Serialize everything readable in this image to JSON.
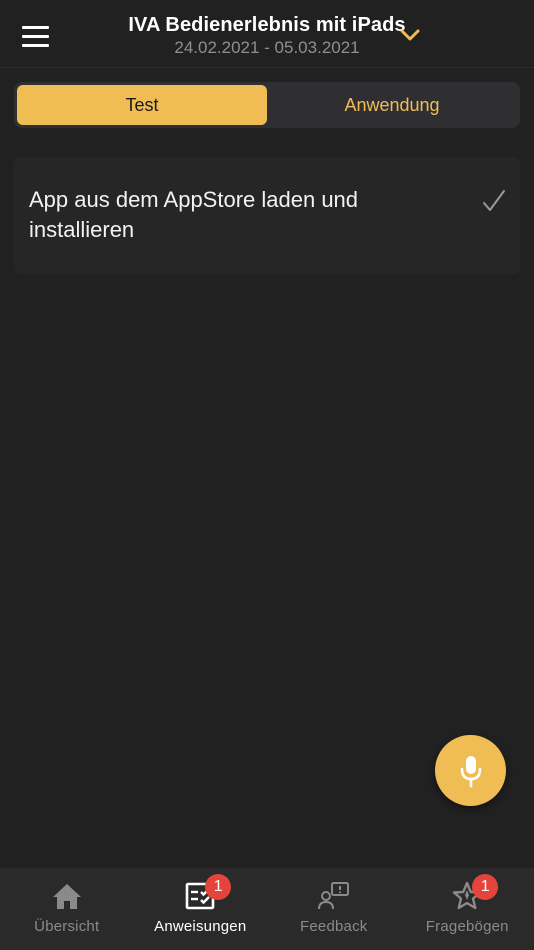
{
  "header": {
    "title": "IVA Bedienerlebnis mit iPads",
    "date_range": "24.02.2021 - 05.03.2021",
    "menu_icon": "hamburger-menu-icon",
    "chevron_icon": "chevron-down-icon"
  },
  "segments": {
    "test_label": "Test",
    "anwendung_label": "Anwendung",
    "active": "Test"
  },
  "task": {
    "text": "App aus dem AppStore laden und installieren",
    "completed": true
  },
  "fab": {
    "icon": "microphone-icon"
  },
  "tabs": [
    {
      "label": "Übersicht",
      "icon": "home-icon",
      "badge": ""
    },
    {
      "label": "Anweisungen",
      "icon": "checklist-icon",
      "badge": "1"
    },
    {
      "label": "Feedback",
      "icon": "feedback-icon",
      "badge": ""
    },
    {
      "label": "Fragebögen",
      "icon": "star-icon",
      "badge": "1"
    }
  ],
  "colors": {
    "background": "#212121",
    "accent": "#f0bd55",
    "badge": "#e5443a",
    "tabbar": "#2a2a2a",
    "card": "#262626"
  }
}
